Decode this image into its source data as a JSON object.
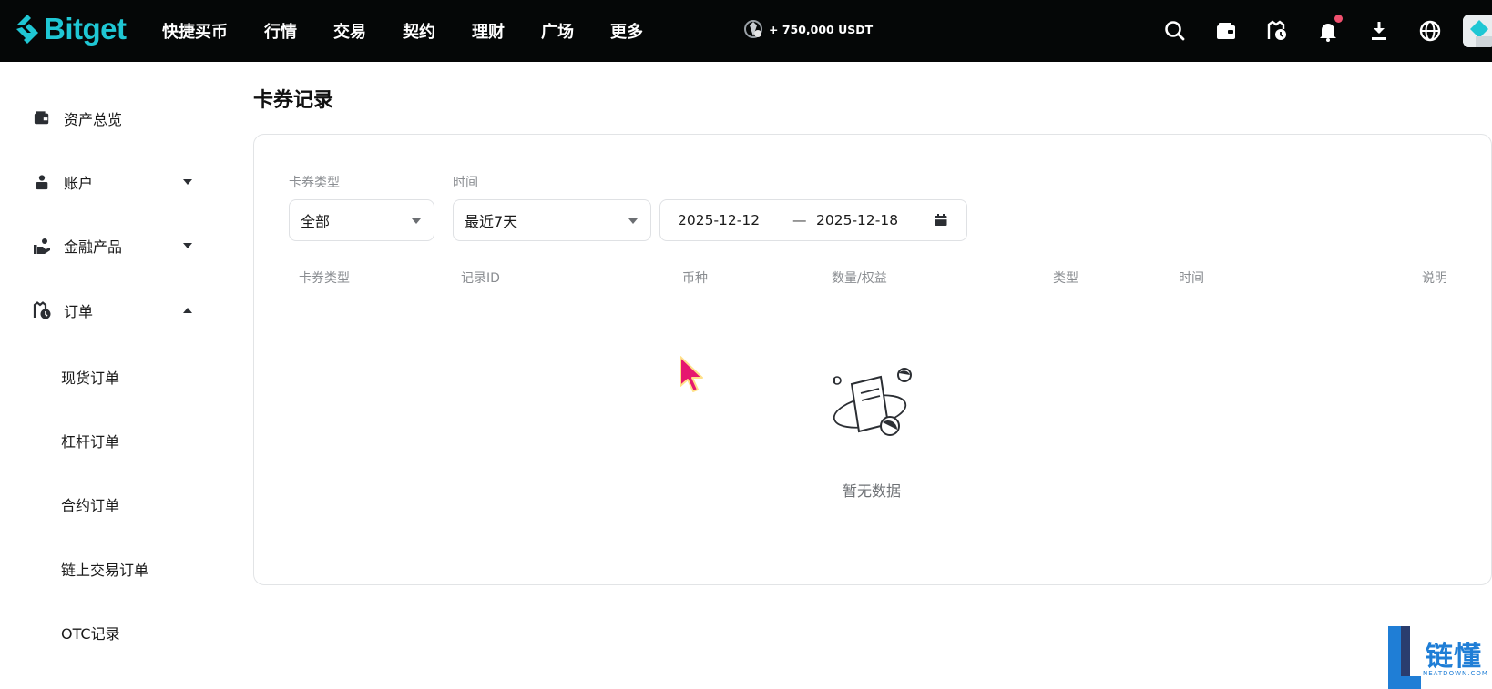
{
  "brand": {
    "name": "Bitget",
    "accent": "#1fc7d4"
  },
  "nav": {
    "items": [
      "快捷买币",
      "行情",
      "交易",
      "契约",
      "理财",
      "广场",
      "更多"
    ],
    "promo": "+ 750,000 USDT",
    "icons": [
      "search-icon",
      "wallet-icon",
      "order-history-icon",
      "bell-icon",
      "download-icon",
      "globe-icon"
    ]
  },
  "sidebar": {
    "items": [
      {
        "label": "资产总览",
        "icon": "wallet-icon"
      },
      {
        "label": "账户",
        "icon": "user-icon",
        "expanded": false
      },
      {
        "label": "金融产品",
        "icon": "finance-icon",
        "expanded": false
      },
      {
        "label": "订单",
        "icon": "order-icon",
        "expanded": true
      }
    ],
    "sub_items": [
      "现货订单",
      "杠杆订单",
      "合约订单",
      "链上交易订单",
      "OTC记录"
    ]
  },
  "main": {
    "title": "卡券记录",
    "filters": {
      "type_label": "卡券类型",
      "type_value": "全部",
      "time_label": "时间",
      "time_value": "最近7天",
      "date_start": "2025-12-12",
      "date_sep": "—",
      "date_end": "2025-12-18"
    },
    "table": {
      "headers": [
        "卡券类型",
        "记录ID",
        "币种",
        "数量/权益",
        "类型",
        "时间",
        "说明"
      ],
      "rows": []
    },
    "empty_text": "暂无数据"
  },
  "watermark": {
    "text": "链懂",
    "sub": "NEATDOWN.COM",
    "color": "#1f7ed6"
  }
}
